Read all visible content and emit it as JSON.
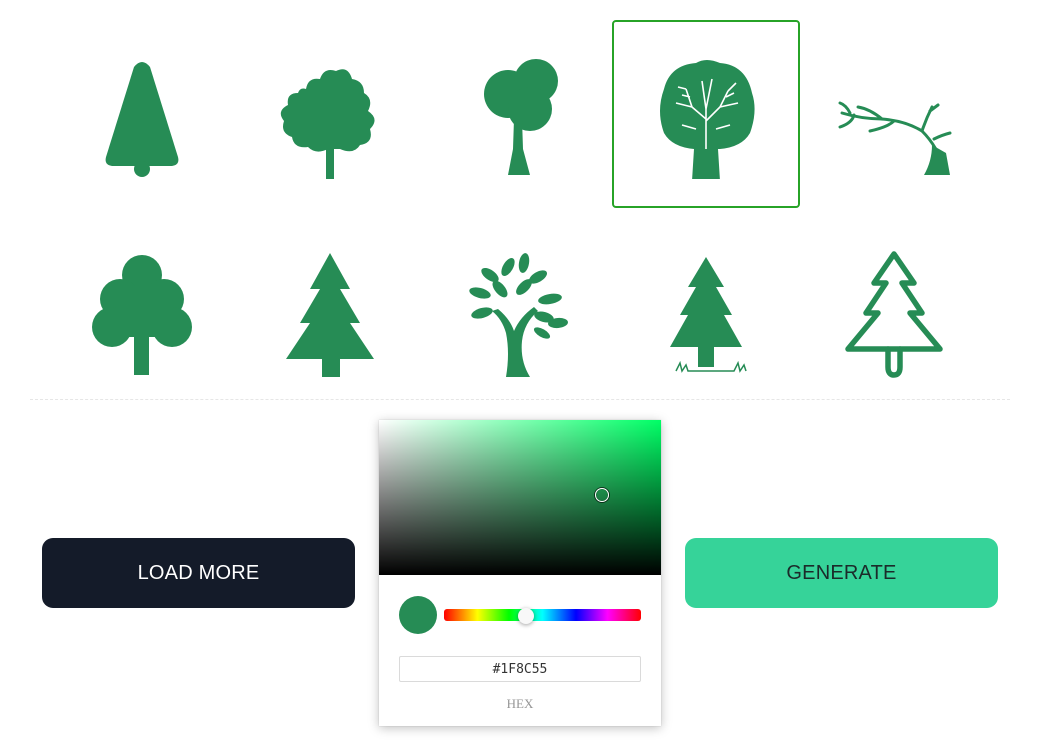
{
  "colors": {
    "icon": "#268c55",
    "selected_border": "#27a327",
    "load_more_bg": "#141b29",
    "generate_bg": "#36d399",
    "hue_base": "#00ff66",
    "swatch": "#268c55"
  },
  "gallery": {
    "selected_index": 3,
    "icons": [
      "triangle-tree-icon",
      "leafy-tree-icon",
      "round-canopy-tree-icon",
      "tree-with-branches-icon",
      "bare-windswept-tree-icon",
      "cloud-tree-icon",
      "pine-tree-icon",
      "leaf-tree-icon",
      "fir-tree-with-grass-icon",
      "outline-pine-tree-icon"
    ]
  },
  "buttons": {
    "load_more": "LOAD MORE",
    "generate": "GENERATE"
  },
  "picker": {
    "hex_value": "#1F8C55",
    "hex_label": "HEX"
  }
}
